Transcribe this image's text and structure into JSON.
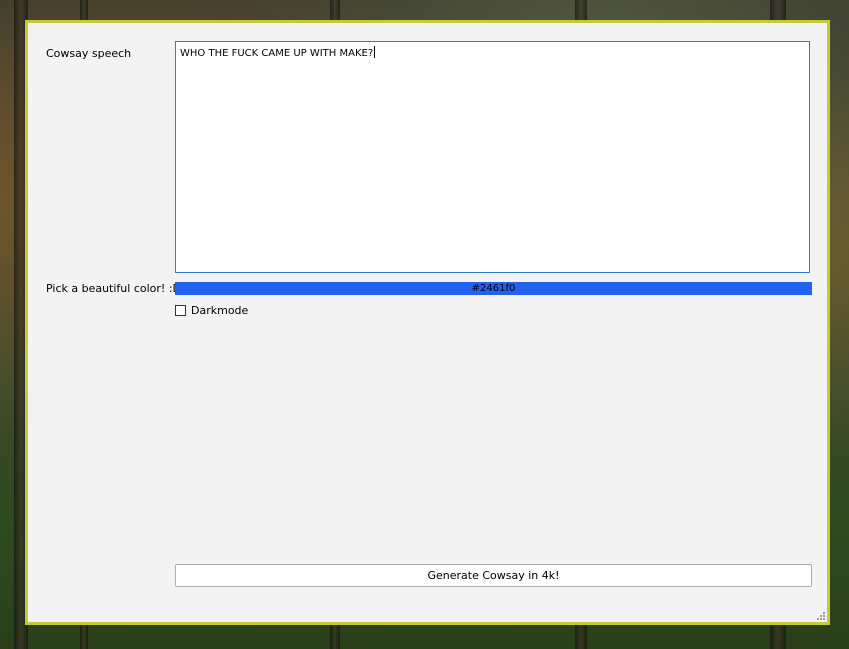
{
  "form": {
    "speech_label": "Cowsay speech",
    "speech_value": "WHO THE FUCK CAME UP WITH MAKE?",
    "color_label": "Pick a beautiful color! :D",
    "color_value": "#2461f0",
    "darkmode_label": "Darkmode",
    "darkmode_checked": false,
    "generate_label": "Generate Cowsay in 4k!"
  },
  "colors": {
    "window_border": "#c6c93a",
    "window_bg": "#f3f3f3",
    "picked_color": "#2461f0",
    "textbox_focus_border": "#2e7fbd"
  },
  "icons": {
    "resize_grip": "size-grip-icon"
  }
}
